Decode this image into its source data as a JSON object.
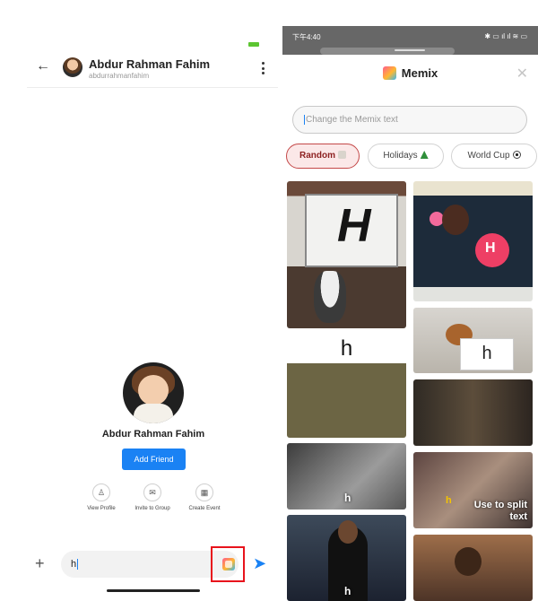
{
  "left": {
    "chat_header": {
      "name": "Abdur Rahman Fahim",
      "username": "abdurrahmanfahim"
    },
    "profile": {
      "name": "Abdur Rahman Fahim",
      "add_friend_label": "Add Friend",
      "actions": [
        {
          "label": "View Profile",
          "icon": "person-icon"
        },
        {
          "label": "Invite to Group",
          "icon": "mail-icon"
        },
        {
          "label": "Create Event",
          "icon": "calendar-icon"
        }
      ]
    },
    "composer": {
      "value": "h"
    }
  },
  "right": {
    "status": {
      "time": "下午4:40",
      "icons": "✱ ▭ ıl ıl ≋ ▭"
    },
    "sheet": {
      "title": "Memix",
      "search_placeholder": "Change the Memix text",
      "chips": [
        {
          "label": "Random",
          "active": true
        },
        {
          "label": "Holidays",
          "active": false
        },
        {
          "label": "World Cup",
          "active": false
        }
      ],
      "gifs": [
        {
          "caption": "H"
        },
        {
          "caption": "h"
        },
        {
          "caption": "h"
        },
        {
          "caption": "h"
        },
        {
          "caption": "H"
        },
        {
          "caption": "h"
        },
        {
          "caption": ""
        },
        {
          "caption": "Use to split text",
          "mark": "h"
        },
        {
          "caption": ""
        }
      ]
    }
  },
  "colors": {
    "accent": "#1a82f4",
    "highlight_box": "#e8131c",
    "active_chip_bg": "#fbe8e8",
    "active_chip_text": "#8c1f1f"
  }
}
